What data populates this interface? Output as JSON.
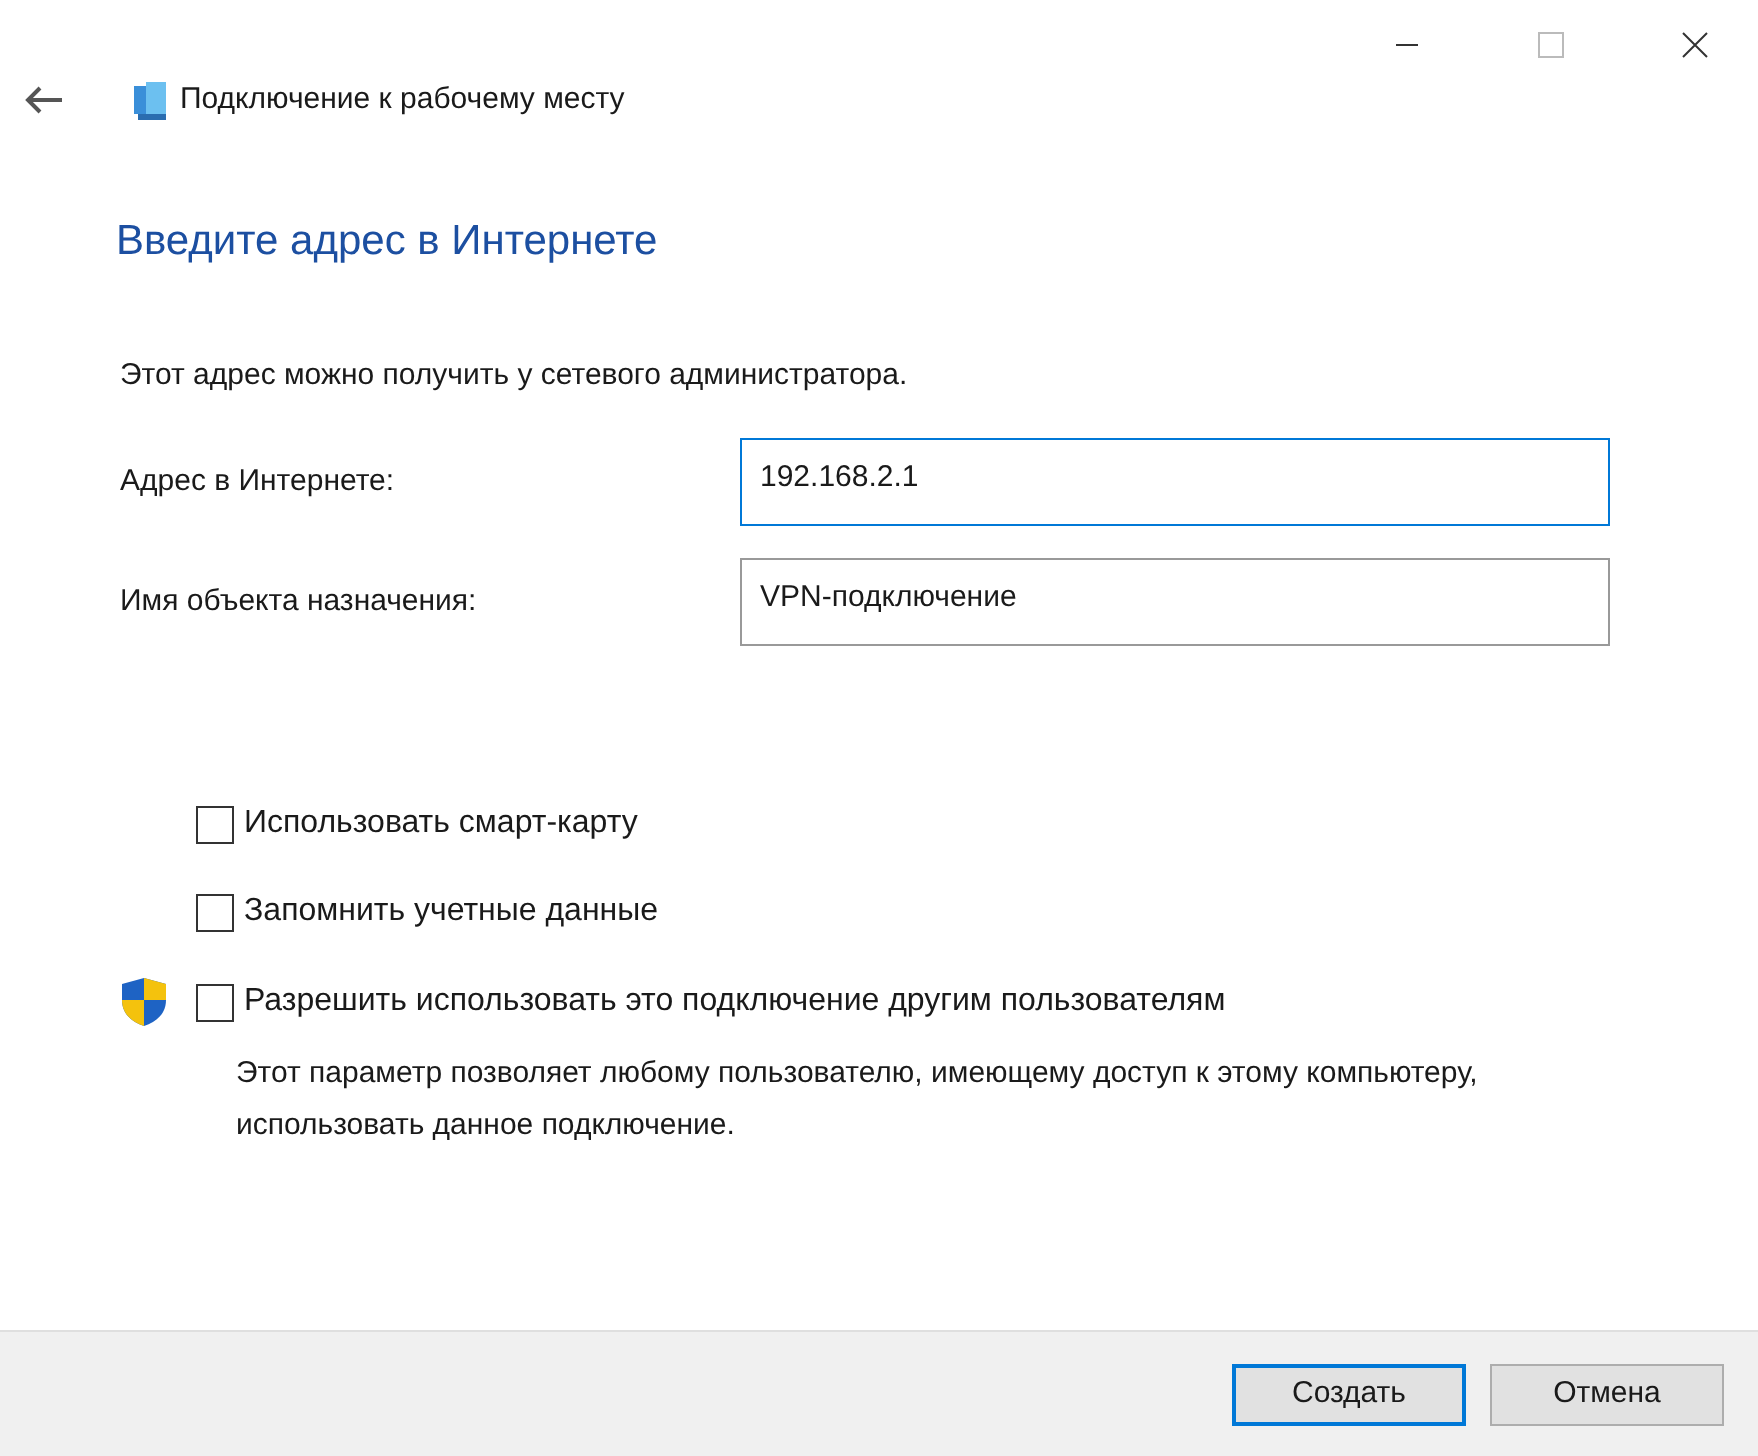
{
  "window": {
    "title": "Подключение к рабочему месту"
  },
  "heading": "Введите адрес в Интернете",
  "instruction": "Этот адрес можно получить у сетевого администратора.",
  "fields": [
    {
      "label": "Адрес в Интернете:",
      "value": "192.168.2.1",
      "focused": true
    },
    {
      "label": "Имя объекта назначения:",
      "value": "VPN-подключение",
      "focused": false
    }
  ],
  "checkboxes": [
    {
      "kind": "plain",
      "label": "Использовать смарт-карту",
      "checked": false
    },
    {
      "kind": "plain",
      "label": "Запомнить учетные данные",
      "checked": false
    },
    {
      "kind": "shield",
      "label": "Разрешить использовать это подключение другим пользователям",
      "checked": false,
      "description": "Этот параметр позволяет любому пользователю, имеющему доступ к этому компьютеру, использовать данное подключение."
    }
  ],
  "buttons": [
    {
      "label": "Создать",
      "default": true
    },
    {
      "label": "Отмена",
      "default": false
    }
  ]
}
